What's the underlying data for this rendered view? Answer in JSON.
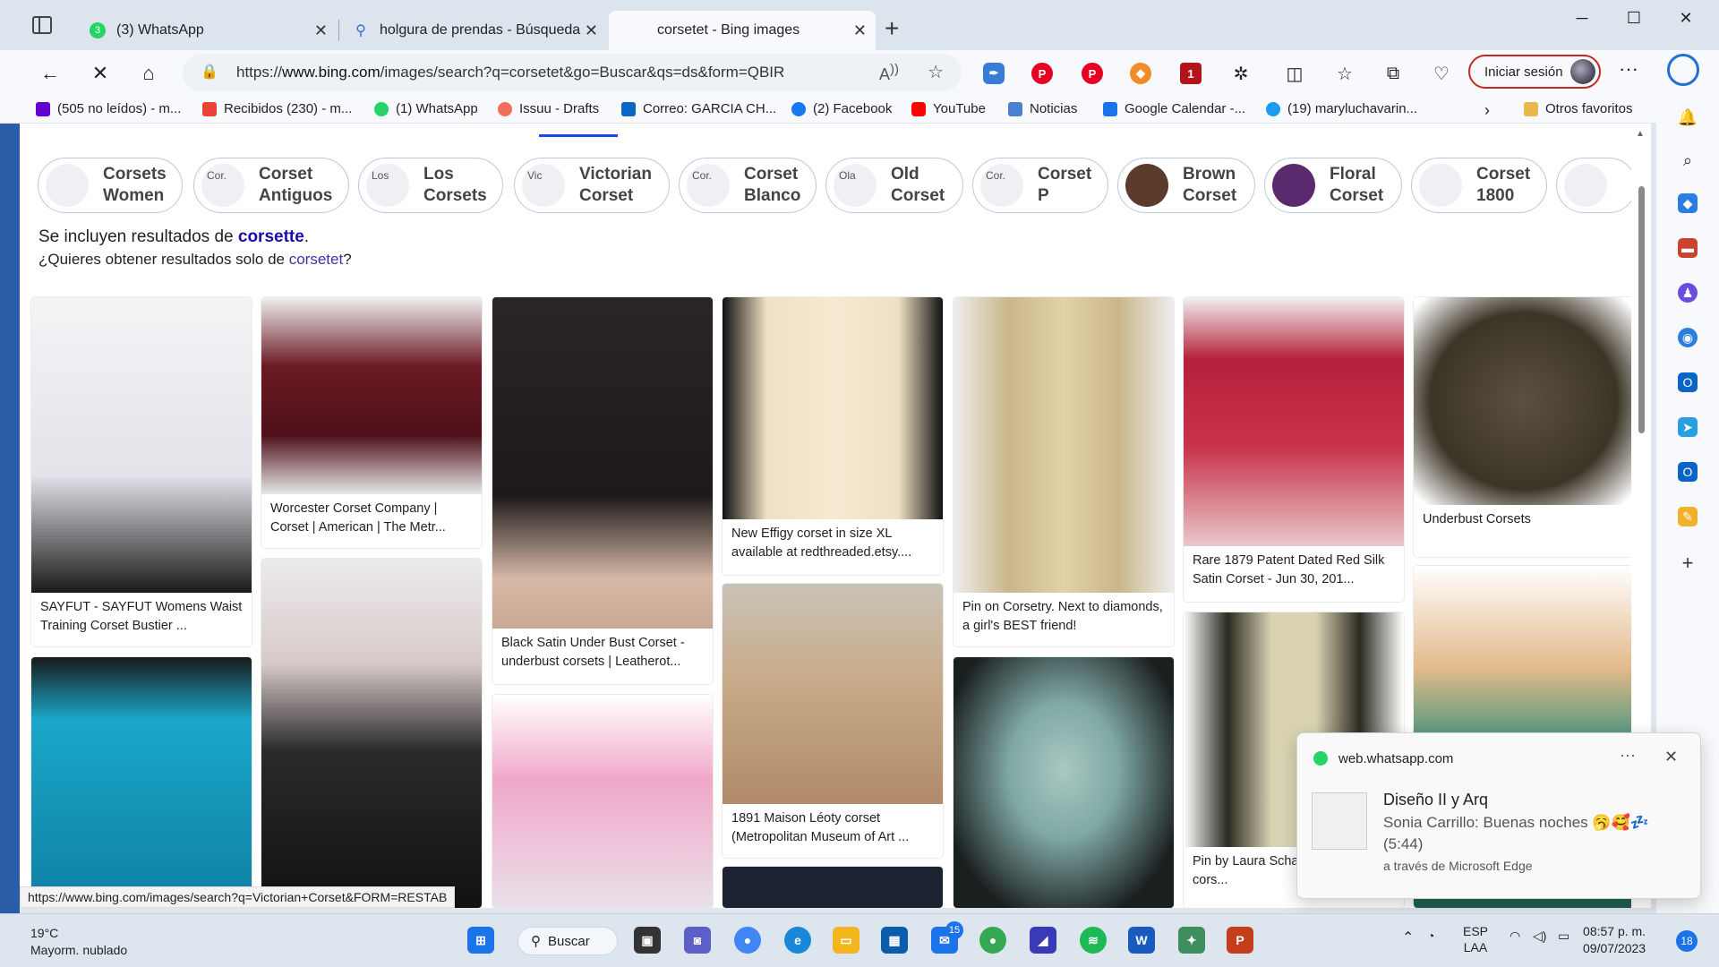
{
  "tabs": [
    {
      "title": "(3) WhatsApp",
      "favicon_color": "#25d366",
      "badge": "3"
    },
    {
      "title": "holgura de prendas - Búsqueda",
      "favicon_color": "#2b6cd6"
    },
    {
      "title": "corsetet - Bing images",
      "favicon_color": "#ffffff"
    }
  ],
  "address": {
    "url_prefix": "https://",
    "url_host": "www.bing.com",
    "url_path": "/images/search?q=corsetet&go=Buscar&qs=ds&form=QBIR"
  },
  "toolbar": {
    "signin_label": "Iniciar sesión",
    "extension_badge": "1"
  },
  "favorites": [
    {
      "label": "(505 no leídos) - m...",
      "color": "#6001d2"
    },
    {
      "label": "Recibidos (230) - m...",
      "color": "#ea4335"
    },
    {
      "label": "(1) WhatsApp",
      "color": "#25d366"
    },
    {
      "label": "Issuu - Drafts",
      "color": "#f36d5d"
    },
    {
      "label": "Correo: GARCIA CH...",
      "color": "#0a66c2"
    },
    {
      "label": "(2) Facebook",
      "color": "#1877f2"
    },
    {
      "label": "YouTube",
      "color": "#ff0000"
    },
    {
      "label": "Noticias",
      "color": "#4a7fd1"
    },
    {
      "label": "Google Calendar -...",
      "color": "#1a73e8"
    },
    {
      "label": "(19) maryluchavarin...",
      "color": "#1d9bf0"
    },
    {
      "label": "Otros favoritos",
      "color": "#e8b84a"
    }
  ],
  "chips": [
    {
      "label": "Corsets Women",
      "alt": ""
    },
    {
      "label": "Corset Antiguos",
      "alt": "Cor."
    },
    {
      "label": "Los Corsets",
      "alt": "Los"
    },
    {
      "label": "Victorian Corset",
      "alt": "Vic"
    },
    {
      "label": "Corset Blanco",
      "alt": "Cor."
    },
    {
      "label": "Old Corset",
      "alt": "Ola"
    },
    {
      "label": "Corset P",
      "alt": "Cor."
    },
    {
      "label": "Brown Corset",
      "alt": ""
    },
    {
      "label": "Floral Corset",
      "alt": ""
    },
    {
      "label": "Corset 1800",
      "alt": ""
    }
  ],
  "notice": {
    "included_prefix": "Se incluyen resultados de ",
    "included_term": "corsette",
    "included_suffix": ".",
    "question_prefix": "¿Quieres obtener resultados solo de ",
    "question_term": "corsetet",
    "question_suffix": "?"
  },
  "results": [
    {
      "caption": "SAYFUT - SAYFUT Womens Waist Training Corset Bustier ...",
      "color": "#e8e8ec"
    },
    {
      "caption": "Worcester Corset Company | Corset | American | The Metr...",
      "color": "#6b1a24"
    },
    {
      "caption": "Black Satin Under Bust Corset - underbust corsets | Leatherot...",
      "color": "#1e1a1a"
    },
    {
      "caption": "New Effigy corset in size XL available at redthreaded.etsy....",
      "color": "#efe0c4"
    },
    {
      "caption": "Pin on Corsetry. Next to diamonds, a girl's BEST friend!",
      "color": "#c9b68a"
    },
    {
      "caption": "Rare 1879 Patent Dated Red Silk Satin Corset - Jun 30, 201...",
      "color": "#b5203a"
    },
    {
      "caption": "Underbust Corsets",
      "color": "#3c3426"
    },
    {
      "caption": "",
      "color": "#1aa7c9"
    },
    {
      "caption": "",
      "color": "#d8c9c9"
    },
    {
      "caption": "",
      "color": "#f0a8c8"
    },
    {
      "caption": "1891 Maison Léoty corset (Metropolitan Museum of Art ...",
      "color": "#c9ad8c"
    },
    {
      "caption": "",
      "color": "#7fa8a4"
    },
    {
      "caption": "Pin by Laura Scha... Steel boned cors...",
      "color": "#d9d3b4"
    },
    {
      "caption": "",
      "color": "#2f8f7c"
    }
  ],
  "status_url": "https://www.bing.com/images/search?q=Victorian+Corset&FORM=RESTAB",
  "notification": {
    "source": "web.whatsapp.com",
    "title": "Diseño II y Arq",
    "message": "Sonia Carrillo: Buenas noches 🥱🥰💤 (5:44)",
    "via": "a través de Microsoft Edge"
  },
  "taskbar": {
    "temperature": "19°C",
    "weather": "Mayorm. nublado",
    "search_label": "Buscar",
    "mail_badge": "15",
    "lang_1": "ESP",
    "lang_2": "LAA",
    "time": "08:57 p. m.",
    "date": "09/07/2023",
    "notifications_count": "18"
  }
}
